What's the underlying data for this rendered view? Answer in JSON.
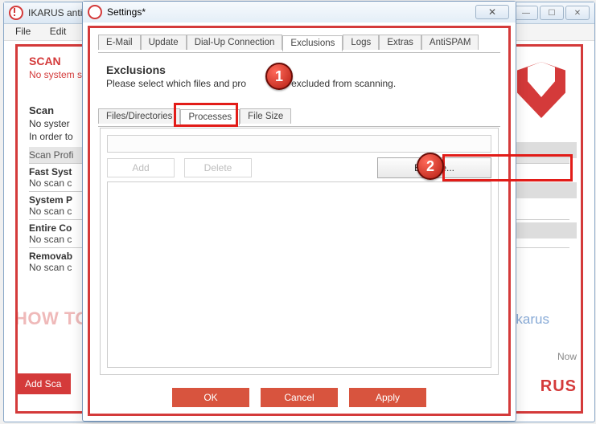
{
  "bg": {
    "title": "IKARUS anti.",
    "menu": {
      "file": "File",
      "edit": "Edit"
    },
    "scan_h": "SCAN",
    "scan_sub": "No system s",
    "scan2_h": "Scan",
    "scan2_l1": "No syster",
    "scan2_l2": "In order to",
    "profiles_hdr": "Scan Profi",
    "rows": [
      {
        "t": "Fast Syst",
        "s": "No scan c"
      },
      {
        "t": "System P",
        "s": "No scan c"
      },
      {
        "t": "Entire Co",
        "s": "No scan c"
      },
      {
        "t": "Removab",
        "s": "No scan c"
      }
    ],
    "add_btn": "Add Sca",
    "now": "Now",
    "logo": "RUS"
  },
  "watermark": "HOW TO WHITELIST SOFTWARE IN IKARUS",
  "watermark_url": "nbots.me/sikarus",
  "dlg": {
    "title": "Settings*",
    "tabs": [
      "E-Mail",
      "Update",
      "Dial-Up Connection",
      "Exclusions",
      "Logs",
      "Extras",
      "AntiSPAM"
    ],
    "tab_selected": "Exclusions",
    "section_h": "Exclusions",
    "section_d_pre": "Please select which files and pro",
    "section_d_post": " are excluded from scanning.",
    "subtabs": [
      "Files/Directories",
      "Processes",
      "File Size"
    ],
    "subtab_selected": "Processes",
    "add": "Add",
    "delete": "Delete",
    "browse": "Browse...",
    "ok": "OK",
    "cancel": "Cancel",
    "apply": "Apply"
  },
  "callouts": {
    "one": "1",
    "two": "2"
  }
}
